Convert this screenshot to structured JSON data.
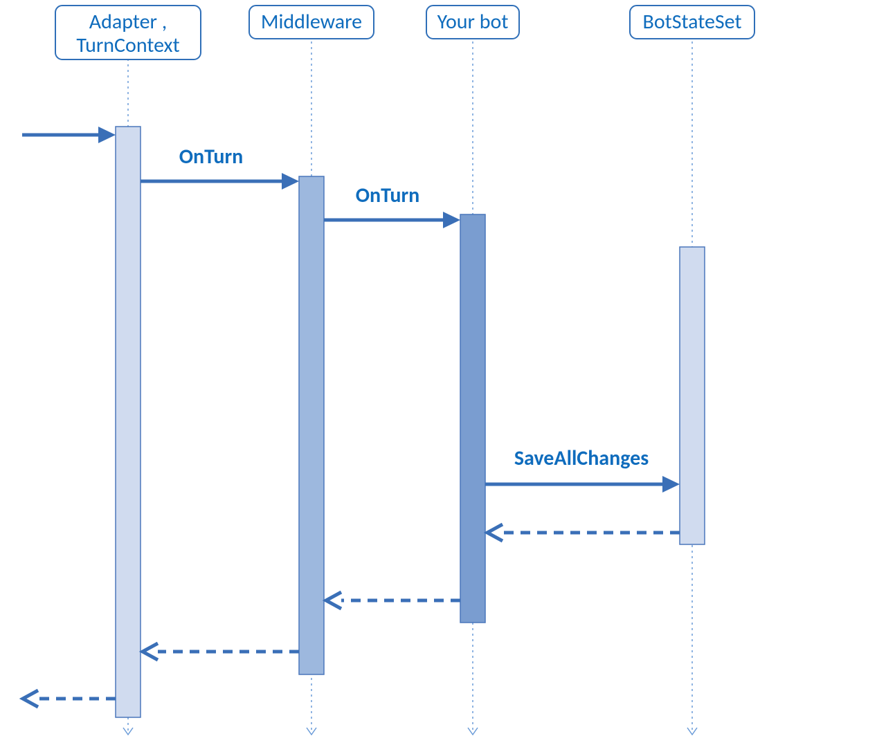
{
  "participants": {
    "adapter": {
      "line1": "Adapter ,",
      "line2": "TurnContext"
    },
    "middleware": {
      "label": "Middleware"
    },
    "yourbot": {
      "label": "Your bot"
    },
    "botstateset": {
      "label": "BotStateSet"
    }
  },
  "messages": {
    "onturn1": "OnTurn",
    "onturn2": "OnTurn",
    "saveall": "SaveAllChanges"
  },
  "colors": {
    "line": "#3a6fb7",
    "text": "#0f6cbd",
    "fill_light": "#d0dbef",
    "fill_mid": "#9db8de",
    "fill_dark": "#7a9dd0"
  }
}
